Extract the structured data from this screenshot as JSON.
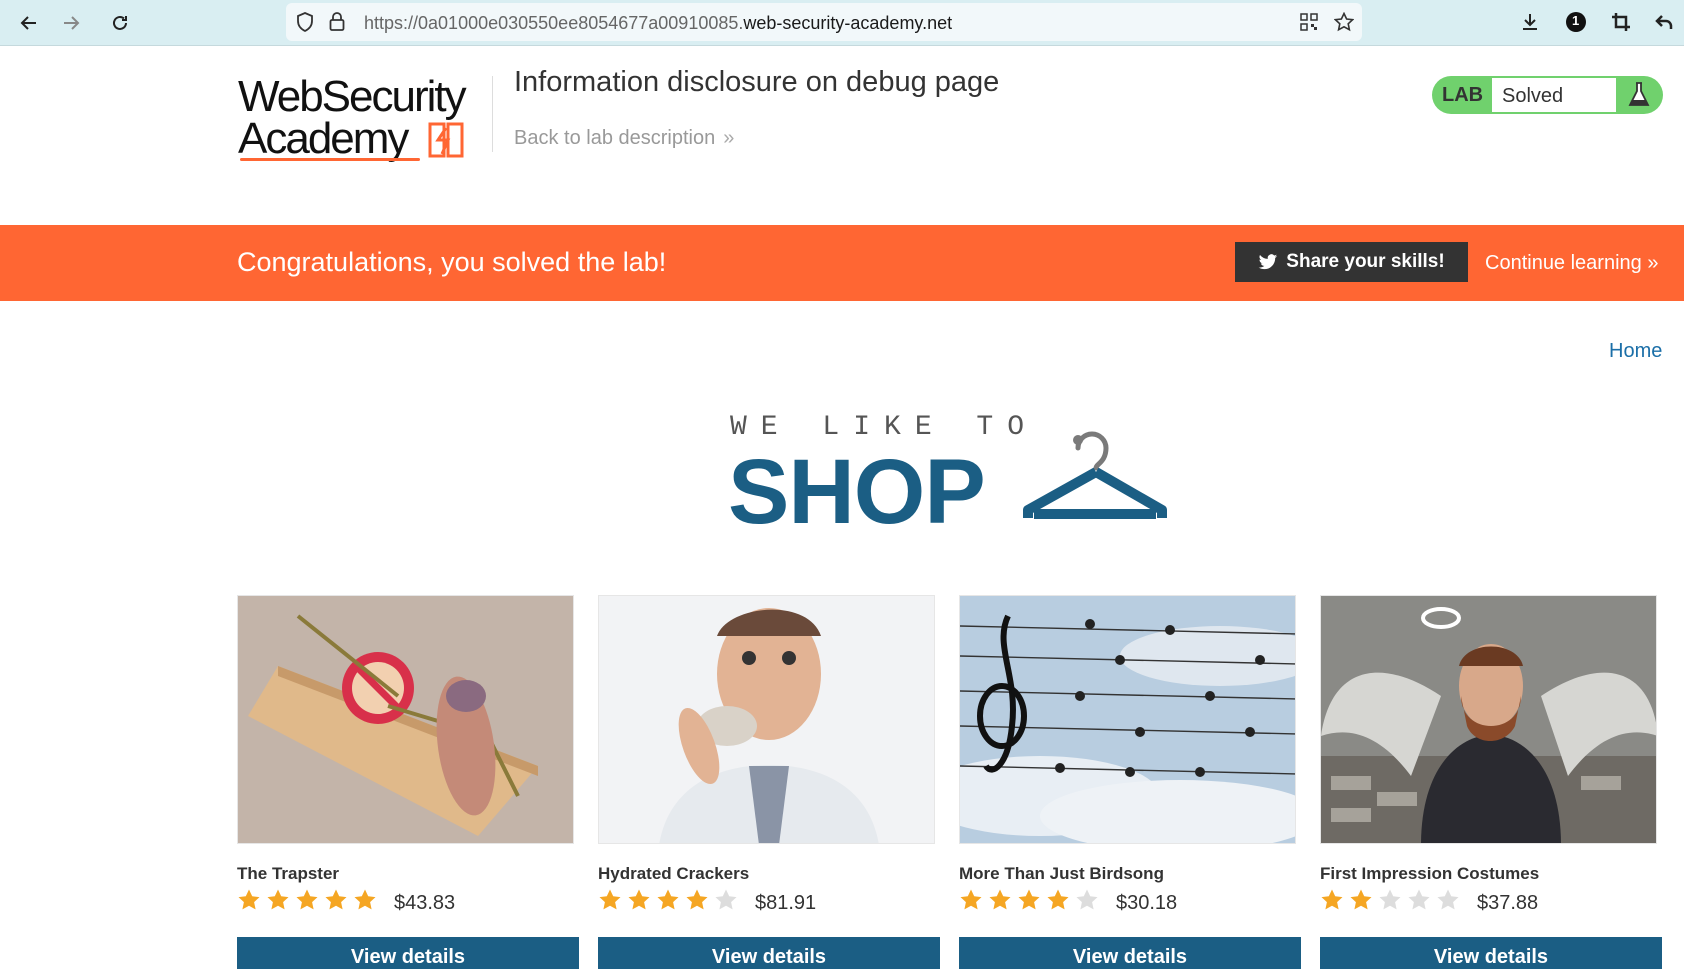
{
  "browser": {
    "url_prefix": "https://0a01000e030550ee8054677a00910085.",
    "url_domain": "web-security-academy.net",
    "badge_count": "1"
  },
  "header": {
    "logo_line1": "WebSecurity",
    "logo_line2": "Academy",
    "lab_title": "Information disclosure on debug page",
    "back_link": "Back to lab description",
    "lab_label": "LAB",
    "lab_status": "Solved"
  },
  "banner": {
    "message": "Congratulations, you solved the lab!",
    "share_label": "Share your skills!",
    "continue_label": "Continue learning"
  },
  "nav": {
    "home": "Home"
  },
  "hero": {
    "tagline": "WE LIKE TO",
    "title": "SHOP"
  },
  "colors": {
    "accent_orange": "#ff6633",
    "brand_blue": "#1b5e84",
    "lab_green": "#70d16d",
    "star_gold": "#f5a623",
    "star_empty": "#dddddd"
  },
  "products": [
    {
      "name": "The Trapster",
      "rating": 5,
      "price": "$43.83",
      "button": "View details",
      "image_icon": "mousetrap-image"
    },
    {
      "name": "Hydrated Crackers",
      "rating": 4,
      "price": "$81.91",
      "button": "View details",
      "image_icon": "man-eating-cracker-image"
    },
    {
      "name": "More Than Just Birdsong",
      "rating": 4,
      "price": "$30.18",
      "button": "View details",
      "image_icon": "birds-on-wires-music-image"
    },
    {
      "name": "First Impression Costumes",
      "rating": 2,
      "price": "$37.88",
      "button": "View details",
      "image_icon": "angel-costume-image"
    }
  ]
}
